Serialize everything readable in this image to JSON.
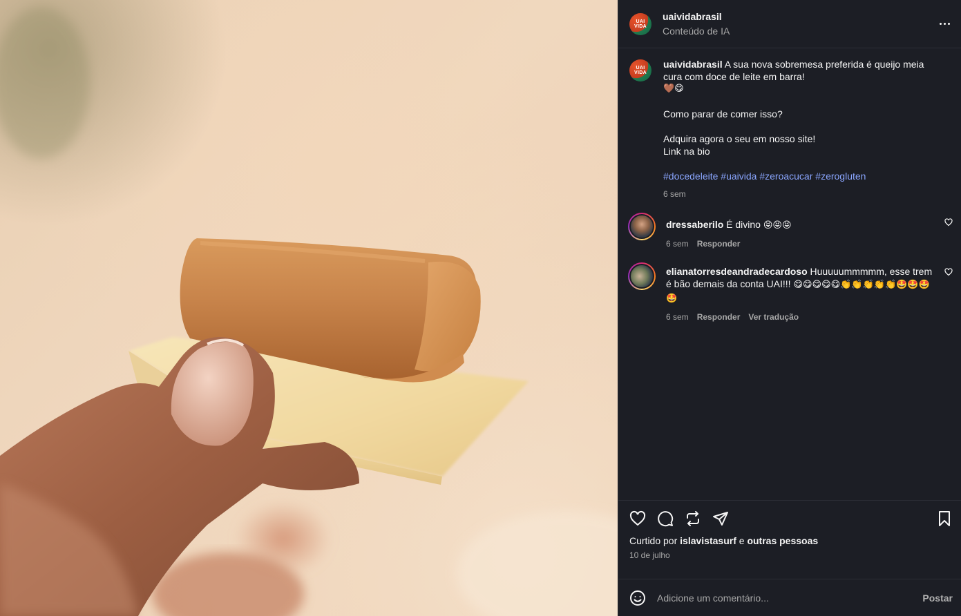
{
  "header": {
    "username": "uaividabrasil",
    "subtitle": "Conteúdo de IA",
    "avatar_text": "UAI VIDA",
    "more_icon": "more-horizontal-icon"
  },
  "caption": {
    "username": "uaividabrasil",
    "line1": "A sua nova sobremesa preferida é queijo meia cura com doce de leite em barra!",
    "emojis": "🤎😋",
    "line2": "Como parar de comer isso?",
    "line3": "Adquira agora o seu em nosso site!",
    "line4": "Link na bio",
    "hashtags": [
      "#docedeleite",
      "#uaivida",
      "#zeroacucar",
      "#zerogluten"
    ],
    "time": "6 sem"
  },
  "comments": [
    {
      "username": "dressaberilo",
      "text": "É divino ",
      "emojis": "😝😝😝",
      "time": "6 sem",
      "reply": "Responder"
    },
    {
      "username": "elianatorresdeandradecardoso",
      "text": "Huuuuummmmm, esse trem é bão demais da conta UAI!!!",
      "emojis": "😋😋😋😋😋👏👏👏👏👏🤩🤩🤩🤩",
      "time": "6 sem",
      "reply": "Responder",
      "translate": "Ver tradução"
    }
  ],
  "likes": {
    "prefix": "Curtido por ",
    "user": "islavistasurf",
    "middle": " e ",
    "others": "outras pessoas"
  },
  "date": "10 de julho",
  "add_comment": {
    "placeholder": "Adicione um comentário...",
    "post_label": "Postar"
  },
  "colors": {
    "panel_bg": "#1c1e25",
    "hashtag": "#8aa6ff",
    "muted": "#a8a8a8"
  }
}
